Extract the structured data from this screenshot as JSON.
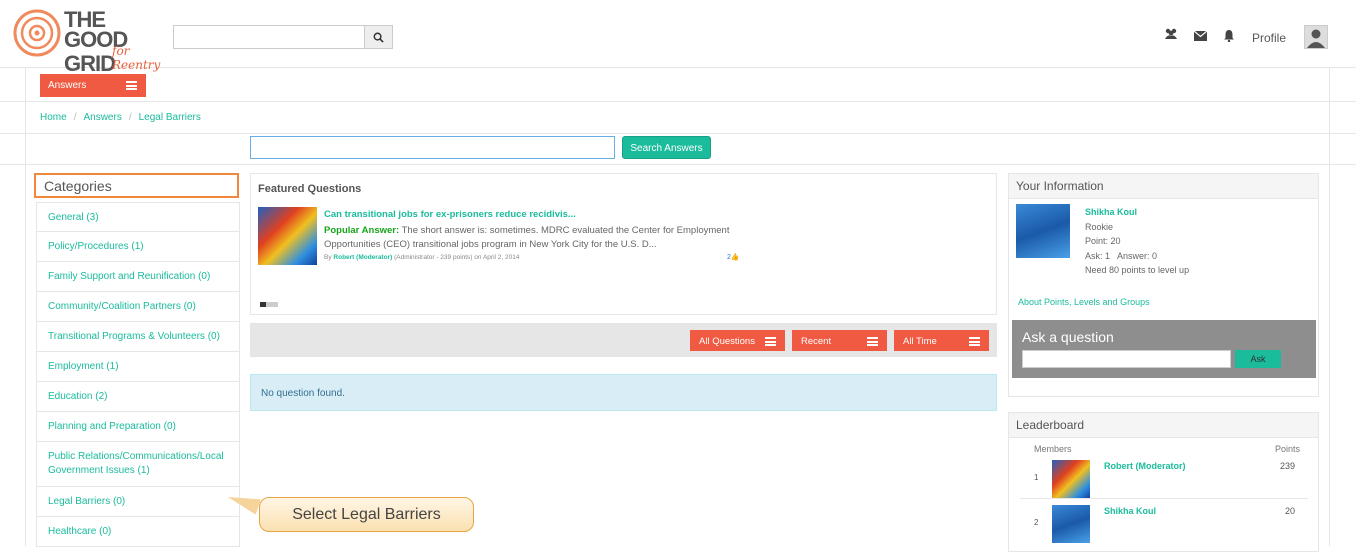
{
  "brand": {
    "logo_line1": "THE GOOD",
    "logo_line2": "GRID",
    "logo_sub": "for Reentry",
    "accent": "#f05a42",
    "link_color": "#1abc9c"
  },
  "header": {
    "search_placeholder": "",
    "profile_label": "Profile",
    "icons": [
      "users-icon",
      "envelope-icon",
      "bell-icon"
    ]
  },
  "nav": {
    "answers_tab": "Answers"
  },
  "breadcrumb": [
    "Home",
    "Answers",
    "Legal Barriers"
  ],
  "answers_search": {
    "button": "Search Answers",
    "value": ""
  },
  "categories": {
    "title": "Categories",
    "items": [
      "General (3)",
      "Policy/Procedures (1)",
      "Family Support and Reunification (0)",
      "Community/Coalition Partners (0)",
      "Transitional Programs & Volunteers (0)",
      "Employment (1)",
      "Education (2)",
      "Planning and Preparation (0)",
      "Public Relations/Communications/Local Government Issues (1)",
      "Legal Barriers (0)",
      "Healthcare (0)"
    ]
  },
  "callout": "Select Legal Barriers",
  "featured": {
    "title": "Featured Questions",
    "question": "Can transitional jobs for ex-prisoners reduce recidivis...",
    "popular_label": "Popular Answer:",
    "answer": "The short answer is: sometimes. MDRC evaluated the Center for Employment Opportunities (CEO) transitional jobs program in New York City for the U.S. D...",
    "by": "By",
    "author": "Robert (Moderator)",
    "author_meta": "(Administrator - 239 points)",
    "date": "on April 2, 2014",
    "votes": "2"
  },
  "filters": [
    "All Questions",
    "Recent",
    "All Time"
  ],
  "no_question": "No question found.",
  "your_info": {
    "title": "Your Information",
    "name": "Shikha Koul",
    "rank": "Rookie",
    "point": "Point: 20",
    "ask_answer": "Ask: 1   Answer: 0",
    "need": "Need 80 points to level up",
    "about_link": "About Points, Levels and Groups",
    "ask_title": "Ask a question",
    "ask_button": "Ask"
  },
  "leaderboard": {
    "title": "Leaderboard",
    "col_members": "Members",
    "col_points": "Points",
    "rows": [
      {
        "rank": "1",
        "name": "Robert (Moderator)",
        "points": "239"
      },
      {
        "rank": "2",
        "name": "Shikha Koul",
        "points": "20"
      }
    ]
  }
}
